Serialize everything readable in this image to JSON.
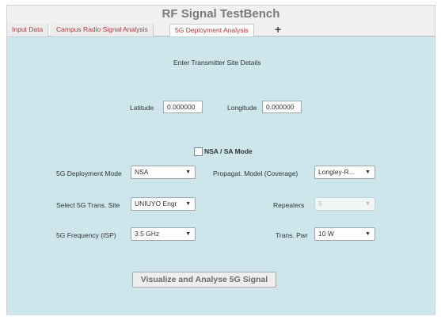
{
  "window": {
    "title": "RF Signal TestBench"
  },
  "tabs": [
    {
      "label": "Input Data"
    },
    {
      "label": "Campus Radio Signal Analysis"
    },
    {
      "label": "5G Deployment Analysis"
    },
    {
      "label": "+"
    }
  ],
  "site": {
    "heading": "Enter Transmitter Site Details",
    "latitude_label": "Latitude",
    "latitude_value": "0.000000",
    "longitude_label": "Longitude",
    "longitude_value": "0.000000"
  },
  "mode_checkbox": {
    "label": "NSA / SA Mode",
    "checked": false
  },
  "fields": {
    "deployment_mode": {
      "label": "5G Deployment Mode",
      "value": "NSA"
    },
    "propagation_model": {
      "label": "Propagat. Model (Coverage)",
      "value": "Longley-R..."
    },
    "trans_site": {
      "label": "Select 5G Trans. Site",
      "value": "UNIUYO Engr"
    },
    "repeaters": {
      "label": "Repeaters",
      "value": "5"
    },
    "frequency": {
      "label": "5G Frequency (ISP)",
      "value": "3.5 GHz"
    },
    "trans_power": {
      "label": "Trans. Pwr",
      "value": "10 W"
    }
  },
  "actions": {
    "visualize_label": "Visualize and Analyse  5G Signal"
  },
  "icons": {
    "dropdown": "chevron-down-icon"
  },
  "colors": {
    "panel_bg": "#cde6ec",
    "tab_text": "#b2383e"
  }
}
